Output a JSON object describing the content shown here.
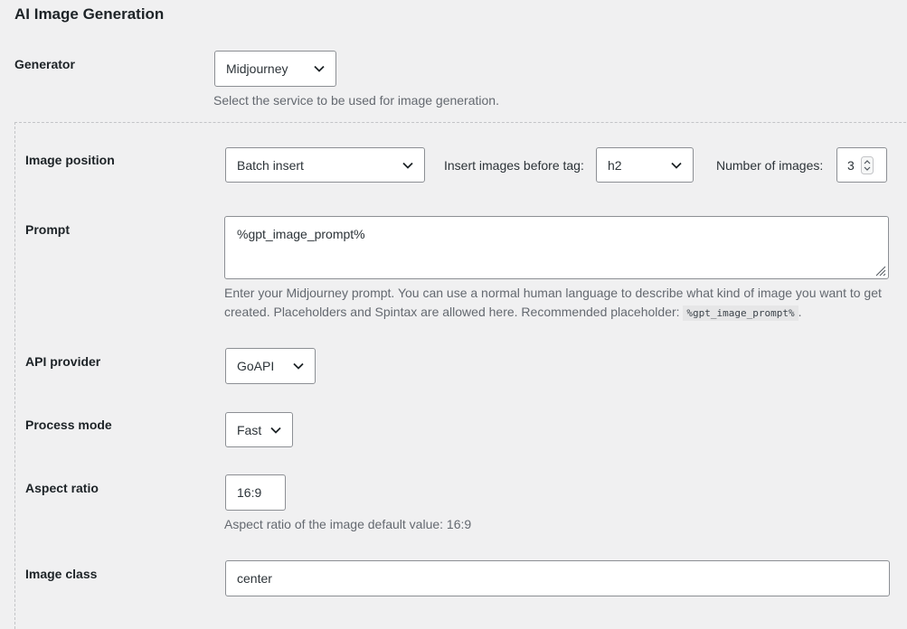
{
  "section": {
    "title": "AI Image Generation"
  },
  "generator": {
    "label": "Generator",
    "value": "Midjourney",
    "description": "Select the service to be used for image generation."
  },
  "image_position": {
    "label": "Image position",
    "value": "Batch insert",
    "before_tag_label": "Insert images before tag:",
    "before_tag_value": "h2",
    "count_label": "Number of images:",
    "count_value": "3"
  },
  "prompt": {
    "label": "Prompt",
    "value": "%gpt_image_prompt%",
    "description_line1": "Enter your Midjourney prompt. You can use a normal human language to describe what kind of image you want to get",
    "description_line2": "created. Placeholders and Spintax are allowed here. Recommended placeholder:",
    "placeholder_code": "%gpt_image_prompt%",
    "trailing": "."
  },
  "api_provider": {
    "label": "API provider",
    "value": "GoAPI"
  },
  "process_mode": {
    "label": "Process mode",
    "value": "Fast"
  },
  "aspect_ratio": {
    "label": "Aspect ratio",
    "value": "16:9",
    "description": "Aspect ratio of the image default value: 16:9"
  },
  "image_class": {
    "label": "Image class",
    "value": "center"
  }
}
